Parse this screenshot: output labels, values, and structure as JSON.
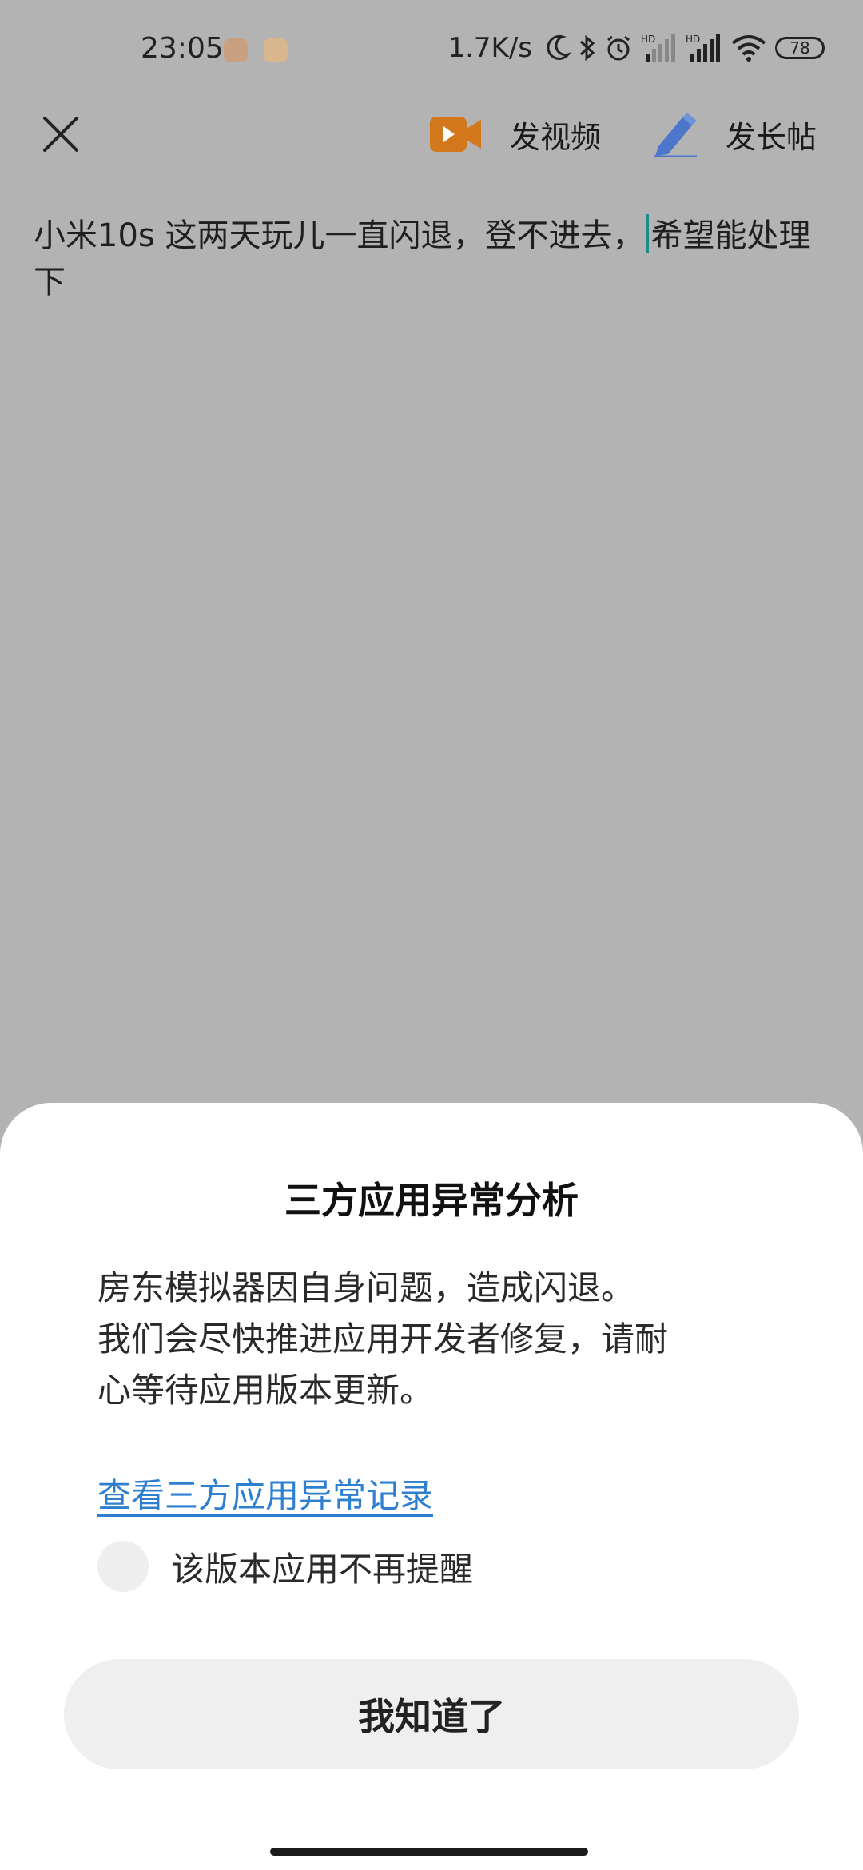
{
  "status_bar": {
    "time": "23:05",
    "net_speed": "1.7K/s",
    "battery": "78",
    "signal_badges": [
      "HD",
      "HD"
    ],
    "icons": [
      "moon-icon",
      "bluetooth-icon",
      "alarm-icon",
      "signal-icon",
      "signal-icon",
      "wifi-icon",
      "battery-icon"
    ]
  },
  "toolbar": {
    "video_label": "发视频",
    "long_post_label": "发长帖",
    "accent_video": "#d2771b",
    "accent_post": "#4b76c9"
  },
  "composer": {
    "text_before_caret": "小米10s 这两天玩儿一直闪退，登不进去，",
    "text_after_caret": "希望能处理下"
  },
  "dialog": {
    "title": "三方应用异常分析",
    "message_lines": [
      "房东模拟器因自身问题，造成闪退。",
      "我们会尽快推进应用开发者修复，请耐",
      "心等待应用版本更新。"
    ],
    "link_text": "查看三方应用异常记录",
    "checkbox_label": "该版本应用不再提醒",
    "confirm_label": "我知道了",
    "link_color": "#2f7fd1"
  }
}
